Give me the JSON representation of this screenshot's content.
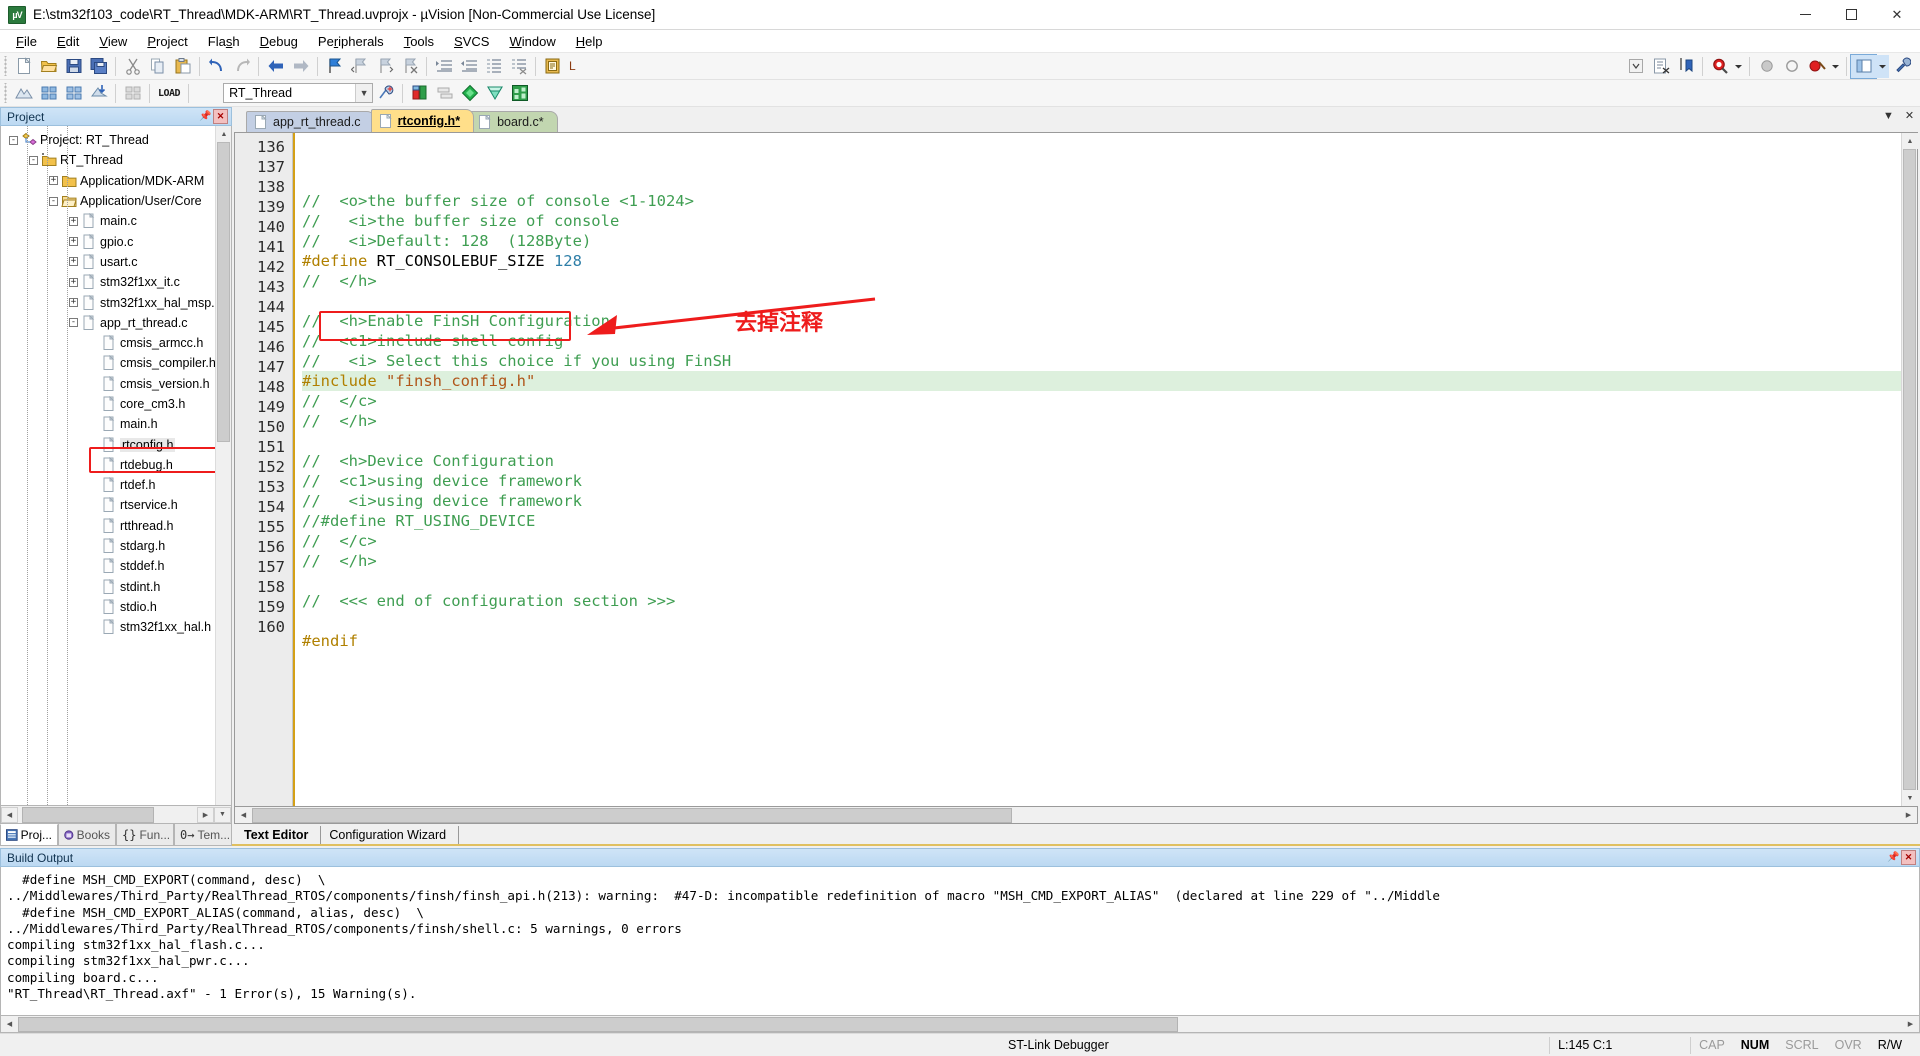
{
  "window": {
    "title": "E:\\stm32f103_code\\RT_Thread\\MDK-ARM\\RT_Thread.uvprojx - µVision  [Non-Commercial Use License]",
    "app_icon": "uvision-icon",
    "minimize_label": "–",
    "maximize_label": "□",
    "close_label": "✕"
  },
  "menu": {
    "items": [
      {
        "label": "File",
        "accel": "F"
      },
      {
        "label": "Edit",
        "accel": "E"
      },
      {
        "label": "View",
        "accel": "V"
      },
      {
        "label": "Project",
        "accel": "P"
      },
      {
        "label": "Flash",
        "accel": "s"
      },
      {
        "label": "Debug",
        "accel": "D"
      },
      {
        "label": "Peripherals",
        "accel": "r"
      },
      {
        "label": "Tools",
        "accel": "T"
      },
      {
        "label": "SVCS",
        "accel": "S"
      },
      {
        "label": "Window",
        "accel": "W"
      },
      {
        "label": "Help",
        "accel": "H"
      }
    ]
  },
  "toolbar_main": {
    "buttons": [
      "new-file-icon",
      "open-file-icon",
      "save-icon",
      "save-all-icon",
      "cut-icon",
      "copy-icon",
      "paste-icon",
      "undo-icon",
      "redo-icon",
      "back-icon",
      "forward-icon",
      "bookmark-toggle-icon",
      "bookmark-prev-icon",
      "bookmark-next-icon",
      "bookmark-clear-icon",
      "indent-icon",
      "outdent-icon",
      "comment-icon",
      "uncomment-icon",
      "build-project-icon"
    ],
    "letter_label": "L",
    "right_buttons": [
      "combo-caret-icon",
      "debug-session-icon",
      "insert-bookmark-icon",
      "find-icon",
      "find-caret-icon",
      "breakpoint-icon",
      "breakpoint-disable-icon",
      "breakpoint-kill-icon",
      "breakpoint-menu-icon",
      "window-layout-icon",
      "layout-caret-icon",
      "configure-icon"
    ]
  },
  "toolbar_build": {
    "buttons": [
      "translate-icon",
      "build-icon",
      "rebuild-icon",
      "batch-build-icon",
      "stop-build-icon",
      "load-label"
    ],
    "load_label": "LOAD",
    "target_value": "RT_Thread",
    "target_caret": "∨",
    "right_buttons": [
      "target-options-icon",
      "manage-runtime-icon",
      "multi-project-icon",
      "new-component-icon",
      "pack-installer-icon",
      "manage-env-icon"
    ]
  },
  "project_pane": {
    "title": "Project",
    "pin_icon": "pin-icon",
    "close_icon": "close-icon",
    "tree": [
      {
        "depth": 0,
        "expander": "-",
        "icon": "project-icon",
        "label": "Project: RT_Thread",
        "selected": false
      },
      {
        "depth": 1,
        "expander": "-",
        "icon": "target-icon",
        "label": "RT_Thread",
        "selected": false
      },
      {
        "depth": 2,
        "expander": "+",
        "icon": "folder-closed-icon",
        "label": "Application/MDK-ARM",
        "selected": false
      },
      {
        "depth": 2,
        "expander": "-",
        "icon": "folder-open-icon",
        "label": "Application/User/Core",
        "selected": false
      },
      {
        "depth": 3,
        "expander": "+",
        "icon": "c-file-icon",
        "label": "main.c",
        "selected": false
      },
      {
        "depth": 3,
        "expander": "+",
        "icon": "c-file-icon",
        "label": "gpio.c",
        "selected": false
      },
      {
        "depth": 3,
        "expander": "+",
        "icon": "c-file-icon",
        "label": "usart.c",
        "selected": false
      },
      {
        "depth": 3,
        "expander": "+",
        "icon": "c-file-icon",
        "label": "stm32f1xx_it.c",
        "selected": false
      },
      {
        "depth": 3,
        "expander": "+",
        "icon": "c-file-icon",
        "label": "stm32f1xx_hal_msp.c",
        "selected": false
      },
      {
        "depth": 3,
        "expander": "-",
        "icon": "c-file-icon",
        "label": "app_rt_thread.c",
        "selected": false
      },
      {
        "depth": 4,
        "expander": "",
        "icon": "h-file-icon",
        "label": "cmsis_armcc.h",
        "selected": false
      },
      {
        "depth": 4,
        "expander": "",
        "icon": "h-file-icon",
        "label": "cmsis_compiler.h",
        "selected": false
      },
      {
        "depth": 4,
        "expander": "",
        "icon": "h-file-icon",
        "label": "cmsis_version.h",
        "selected": false
      },
      {
        "depth": 4,
        "expander": "",
        "icon": "h-file-icon",
        "label": "core_cm3.h",
        "selected": false
      },
      {
        "depth": 4,
        "expander": "",
        "icon": "h-file-icon",
        "label": "main.h",
        "selected": false
      },
      {
        "depth": 4,
        "expander": "",
        "icon": "h-file-icon",
        "label": "rtconfig.h",
        "selected": true
      },
      {
        "depth": 4,
        "expander": "",
        "icon": "h-file-icon",
        "label": "rtdebug.h",
        "selected": false
      },
      {
        "depth": 4,
        "expander": "",
        "icon": "h-file-icon",
        "label": "rtdef.h",
        "selected": false
      },
      {
        "depth": 4,
        "expander": "",
        "icon": "h-file-icon",
        "label": "rtservice.h",
        "selected": false
      },
      {
        "depth": 4,
        "expander": "",
        "icon": "h-file-icon",
        "label": "rtthread.h",
        "selected": false
      },
      {
        "depth": 4,
        "expander": "",
        "icon": "h-file-icon",
        "label": "stdarg.h",
        "selected": false
      },
      {
        "depth": 4,
        "expander": "",
        "icon": "h-file-icon",
        "label": "stddef.h",
        "selected": false
      },
      {
        "depth": 4,
        "expander": "",
        "icon": "h-file-icon",
        "label": "stdint.h",
        "selected": false
      },
      {
        "depth": 4,
        "expander": "",
        "icon": "h-file-icon",
        "label": "stdio.h",
        "selected": false
      },
      {
        "depth": 4,
        "expander": "",
        "icon": "h-file-icon",
        "label": "stm32f1xx_hal.h",
        "selected": false
      }
    ],
    "tabs": [
      {
        "label": "Proj...",
        "icon": "project-tab-icon",
        "active": true
      },
      {
        "label": "Books",
        "icon": "books-tab-icon",
        "active": false
      },
      {
        "label": "Fun...",
        "icon": "functions-tab-icon",
        "active": false
      },
      {
        "label": "Tem...",
        "icon": "templates-tab-icon",
        "active": false
      }
    ]
  },
  "editor": {
    "tabs": [
      {
        "label": "app_rt_thread.c",
        "icon": "c-file-icon",
        "active": false,
        "modified": false
      },
      {
        "label": "rtconfig.h*",
        "icon": "h-file-icon",
        "active": true,
        "modified": true
      },
      {
        "label": "board.c*",
        "icon": "c-file-icon",
        "active": false,
        "modified": true
      }
    ],
    "tab_collapse_icon": "▼",
    "tab_close_icon": "✕",
    "first_line": 136,
    "lines": [
      {
        "n": 136,
        "hl": false,
        "tokens": [
          {
            "t": "//  <o>the buffer size of console <1-1024>",
            "c": "c-comment"
          }
        ]
      },
      {
        "n": 137,
        "hl": false,
        "tokens": [
          {
            "t": "//   <i>the buffer size of console",
            "c": "c-comment"
          }
        ]
      },
      {
        "n": 138,
        "hl": false,
        "tokens": [
          {
            "t": "//   <i>Default: 128  (128Byte)",
            "c": "c-comment"
          }
        ]
      },
      {
        "n": 139,
        "hl": false,
        "tokens": [
          {
            "t": "#define",
            "c": "c-pre"
          },
          {
            "t": " RT_CONSOLEBUF_SIZE ",
            "c": "c-plain"
          },
          {
            "t": "128",
            "c": "c-num"
          }
        ]
      },
      {
        "n": 140,
        "hl": false,
        "tokens": [
          {
            "t": "//  </h>",
            "c": "c-comment"
          }
        ]
      },
      {
        "n": 141,
        "hl": false,
        "tokens": [
          {
            "t": "",
            "c": "c-plain"
          }
        ]
      },
      {
        "n": 142,
        "hl": false,
        "tokens": [
          {
            "t": "//  <h>Enable FinSH Configuration",
            "c": "c-comment"
          }
        ]
      },
      {
        "n": 143,
        "hl": false,
        "tokens": [
          {
            "t": "//  <c1>include shell config",
            "c": "c-comment"
          }
        ]
      },
      {
        "n": 144,
        "hl": false,
        "tokens": [
          {
            "t": "//   <i> Select this choice if you using FinSH",
            "c": "c-comment"
          }
        ]
      },
      {
        "n": 145,
        "hl": true,
        "tokens": [
          {
            "t": "#include",
            "c": "c-pre"
          },
          {
            "t": " ",
            "c": "c-plain"
          },
          {
            "t": "\"finsh_config.h\"",
            "c": "c-str"
          }
        ]
      },
      {
        "n": 146,
        "hl": false,
        "tokens": [
          {
            "t": "//  </c>",
            "c": "c-comment"
          }
        ]
      },
      {
        "n": 147,
        "hl": false,
        "tokens": [
          {
            "t": "//  </h>",
            "c": "c-comment"
          }
        ]
      },
      {
        "n": 148,
        "hl": false,
        "tokens": [
          {
            "t": "",
            "c": "c-plain"
          }
        ]
      },
      {
        "n": 149,
        "hl": false,
        "tokens": [
          {
            "t": "//  <h>Device Configuration",
            "c": "c-comment"
          }
        ]
      },
      {
        "n": 150,
        "hl": false,
        "tokens": [
          {
            "t": "//  <c1>using device framework",
            "c": "c-comment"
          }
        ]
      },
      {
        "n": 151,
        "hl": false,
        "tokens": [
          {
            "t": "//   <i>using device framework",
            "c": "c-comment"
          }
        ]
      },
      {
        "n": 152,
        "hl": false,
        "tokens": [
          {
            "t": "//#define RT_USING_DEVICE",
            "c": "c-comment"
          }
        ]
      },
      {
        "n": 153,
        "hl": false,
        "tokens": [
          {
            "t": "//  </c>",
            "c": "c-comment"
          }
        ]
      },
      {
        "n": 154,
        "hl": false,
        "tokens": [
          {
            "t": "//  </h>",
            "c": "c-comment"
          }
        ]
      },
      {
        "n": 155,
        "hl": false,
        "tokens": [
          {
            "t": "",
            "c": "c-plain"
          }
        ]
      },
      {
        "n": 156,
        "hl": false,
        "tokens": [
          {
            "t": "//  <<< end of configuration section >>>",
            "c": "c-comment"
          }
        ]
      },
      {
        "n": 157,
        "hl": false,
        "tokens": [
          {
            "t": "",
            "c": "c-plain"
          }
        ]
      },
      {
        "n": 158,
        "hl": false,
        "tokens": [
          {
            "t": "#endif",
            "c": "c-pre"
          }
        ]
      },
      {
        "n": 159,
        "hl": false,
        "tokens": [
          {
            "t": "",
            "c": "c-plain"
          }
        ]
      },
      {
        "n": 160,
        "hl": false,
        "tokens": [
          {
            "t": "",
            "c": "c-plain"
          }
        ]
      }
    ],
    "bottom_tabs": [
      {
        "label": "Text Editor",
        "active": true
      },
      {
        "label": "Configuration Wizard",
        "active": false
      }
    ]
  },
  "annotation": {
    "text": "去掉注释",
    "color": "#ee1c1c",
    "arrow_icon": "arrow-left-icon",
    "box_icon": "red-highlight-box"
  },
  "build_output": {
    "title": "Build Output",
    "pin_icon": "pin-icon",
    "close_icon": "close-icon",
    "text": "  #define MSH_CMD_EXPORT(command, desc)  \\\n../Middlewares/Third_Party/RealThread_RTOS/components/finsh/finsh_api.h(213): warning:  #47-D: incompatible redefinition of macro \"MSH_CMD_EXPORT_ALIAS\"  (declared at line 229 of \"../Middle\n  #define MSH_CMD_EXPORT_ALIAS(command, alias, desc)  \\\n../Middlewares/Third_Party/RealThread_RTOS/components/finsh/shell.c: 5 warnings, 0 errors\ncompiling stm32f1xx_hal_flash.c...\ncompiling stm32f1xx_hal_pwr.c...\ncompiling board.c...\n\"RT_Thread\\RT_Thread.axf\" - 1 Error(s), 15 Warning(s)."
  },
  "statusbar": {
    "debugger": "ST-Link Debugger",
    "cursor": "L:145 C:1",
    "cap": "CAP",
    "num": "NUM",
    "scrl": "SCRL",
    "ovr": "OVR",
    "rw": "R/W"
  }
}
